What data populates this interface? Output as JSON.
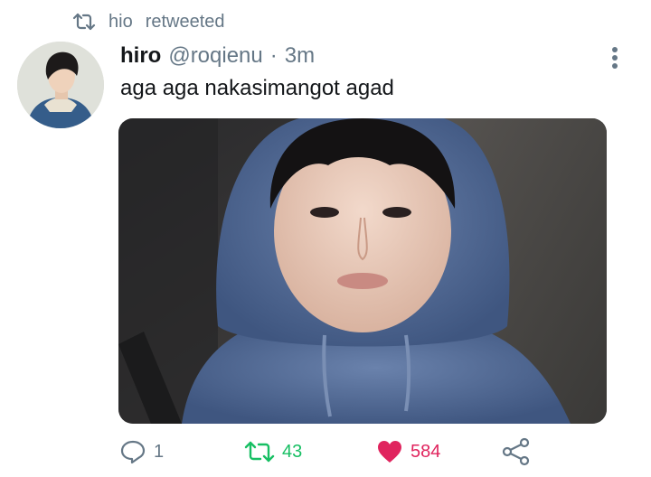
{
  "retweet_banner": {
    "icon": "retweet-icon",
    "user": "hio",
    "label": "retweeted"
  },
  "tweet": {
    "display_name": "hiro",
    "handle": "@roqienu",
    "separator": "·",
    "time": "3m",
    "text": "aga aga nakasimangot agad"
  },
  "actions": {
    "reply": {
      "icon": "reply-icon",
      "count": "1"
    },
    "retweet": {
      "icon": "retweet-icon",
      "count": "43",
      "active": true
    },
    "like": {
      "icon": "heart-icon",
      "count": "584",
      "active": true
    },
    "share": {
      "icon": "share-icon"
    }
  },
  "colors": {
    "muted": "#657786",
    "retweet_active": "#17bf63",
    "like_active": "#e0245e",
    "text": "#14171a"
  }
}
